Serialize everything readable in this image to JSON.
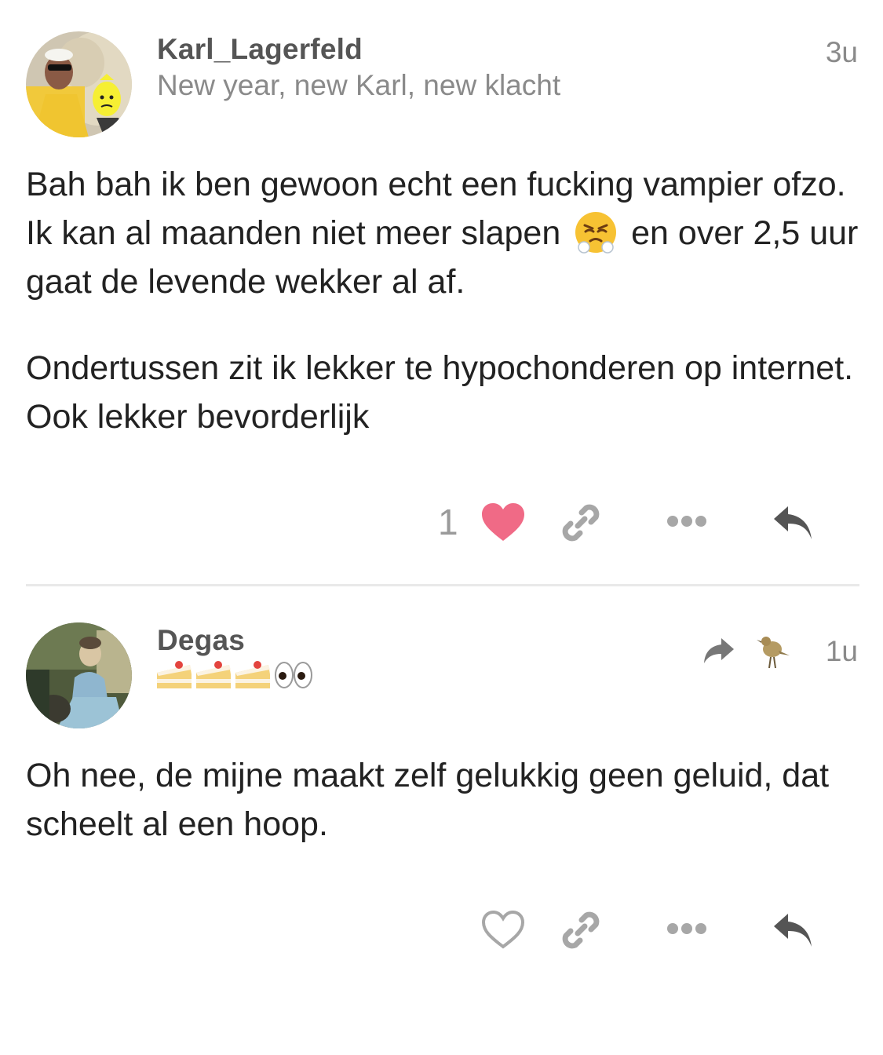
{
  "posts": [
    {
      "username": "Karl_Lagerfeld",
      "user_title": "New year, new Karl, new klacht",
      "time": "3u",
      "paragraph_1_before_emoji": "Bah bah ik ben gewoon echt een fucking vampier ofzo. Ik kan al maanden niet meer slapen",
      "emoji": "face-with-steam-from-nose",
      "paragraph_1_after_emoji": "en over 2,5 uur gaat de levende wekker al af.",
      "paragraph_2": "Ondertussen zit ik lekker te hypochonderen op internet. Ook lekker bevorderlijk",
      "like_count": "1",
      "liked": true
    },
    {
      "username": "Degas",
      "flair_emoji": [
        "shortcake",
        "shortcake",
        "shortcake",
        "eyes"
      ],
      "time": "1u",
      "reply_to_icon": "share-arrow-icon",
      "reply_to_avatar": "bird-avatar",
      "paragraph_1": "Oh nee, de mijne maakt zelf gelukkig geen geluid, dat scheelt al een hoop.",
      "liked": false
    }
  ],
  "colors": {
    "like_active": "#f06a86",
    "icon_gray": "#a7a7a7",
    "icon_dark": "#555555",
    "text": "#222222",
    "meta": "#8a8a8a"
  }
}
